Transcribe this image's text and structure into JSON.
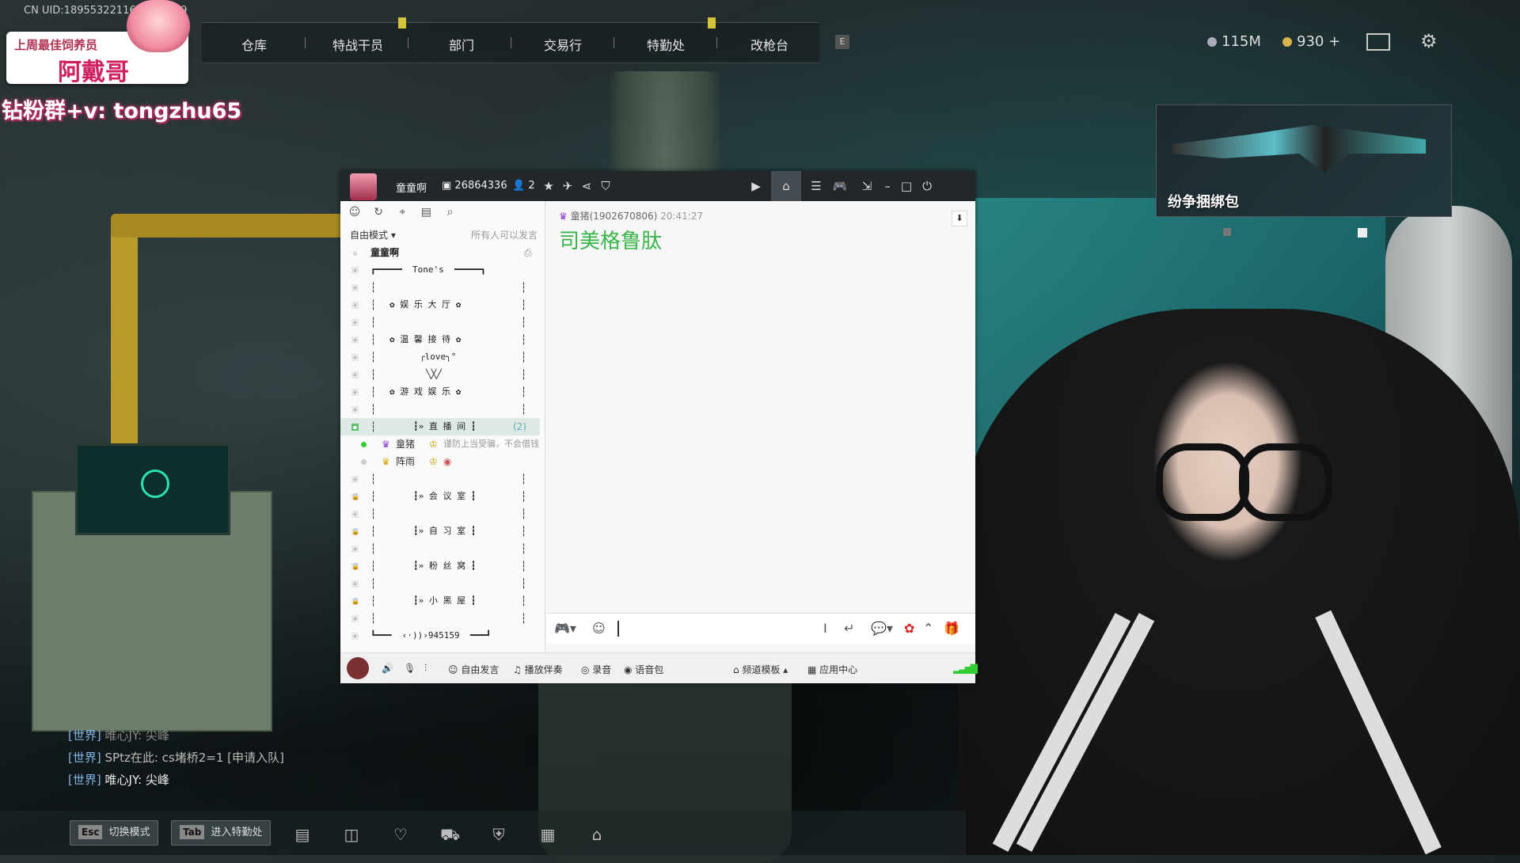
{
  "hud": {
    "uid": "CN UID:18955322116?9445479",
    "nav": [
      "仓库",
      "特战干员",
      "部门",
      "交易行",
      "特勤处",
      "改枪台"
    ],
    "nav_key": "E",
    "currency_silver": "115M",
    "currency_gold": "930 +"
  },
  "overlay": {
    "badge_line1": "上周最佳饲养员",
    "badge_line2": "阿戴哥",
    "fans_text": "钻粉群+v: tongzhu65"
  },
  "promo": {
    "label": "纷争捆绑包"
  },
  "world_chat": [
    {
      "channel": "[世界]",
      "text": "唯心JY: 尖峰"
    },
    {
      "channel": "[世界]",
      "text": "SPtz在此: cs堵桥2=1 [申请入队]"
    },
    {
      "channel": "[世界]",
      "text": "唯心JY: 尖峰"
    }
  ],
  "bottom_bar": {
    "esc_key": "Esc",
    "esc_label": "切换模式",
    "tab_key": "Tab",
    "tab_label": "进入特勤处"
  },
  "yy": {
    "title_name": "童童啊",
    "channel_id": "26864336",
    "member_count": "2",
    "mode": "自由模式",
    "permission": "所有人可以发言",
    "channel_root": "童童啊",
    "tree": [
      "┏━━━━━  Tone's  ━━━━━┓",
      "┆",
      "✿ 娱 乐 大 厅 ✿",
      "┆",
      "✿ 温 馨 接 待 ✿",
      "╭love╮°",
      "╲╳╱",
      "✿ 游 戏 娱 乐 ✿",
      "┆",
      "┇» 直 播 间 ┇",
      "童猪",
      "阵雨",
      "┆",
      "┇» 会 议 室 ┇",
      "┆",
      "┇» 自 习 室 ┇",
      "┆",
      "┇» 粉 丝 窝 ┇",
      "┆",
      "┇» 小 黑 屋 ┇",
      "┆",
      "┗━━━  ‹·))›945159  ━━━┛"
    ],
    "live_room_count": "(2)",
    "user1_name": "童猪",
    "user1_status": "谨防上当受骗，不会借钱",
    "user2_name": "阵雨",
    "message_meta_user": "童猪(1902670806)",
    "message_meta_time": "20:41:27",
    "message_text": "司美格鲁肽",
    "bottom": {
      "free_speak": "自由发言",
      "play_music": "播放伴奏",
      "record": "录音",
      "voice_pack": "语音包",
      "channel_template": "频道模板",
      "app_center": "应用中心"
    }
  }
}
